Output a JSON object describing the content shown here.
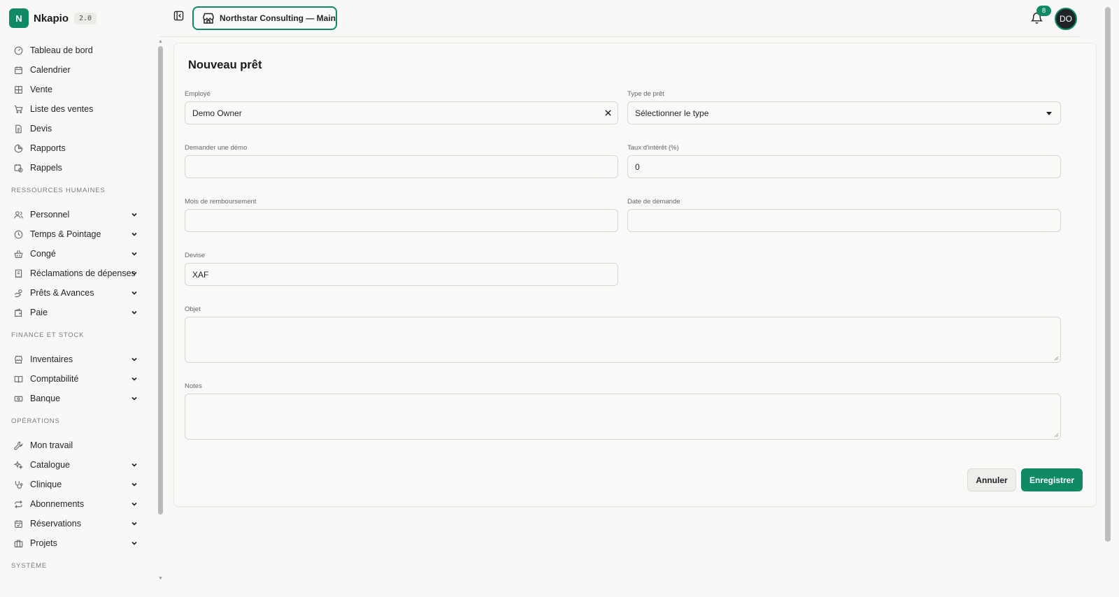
{
  "brand": {
    "logo_letter": "N",
    "name": "Nkapio",
    "version": "2.0"
  },
  "sidebar": {
    "main_items": [
      {
        "label": "Tableau de bord",
        "icon": "dashboard-gauge-icon"
      },
      {
        "label": "Calendrier",
        "icon": "calendar-icon"
      },
      {
        "label": "Vente",
        "icon": "grid-icon"
      },
      {
        "label": "Liste des ventes",
        "icon": "cart-icon"
      },
      {
        "label": "Devis",
        "icon": "document-icon"
      },
      {
        "label": "Rapports",
        "icon": "pie-chart-icon"
      },
      {
        "label": "Rappels",
        "icon": "calendar-clock-icon"
      }
    ],
    "sections": [
      {
        "title": "RESSOURCES HUMAINES",
        "items": [
          {
            "label": "Personnel",
            "icon": "users-icon"
          },
          {
            "label": "Temps & Pointage",
            "icon": "clock-icon"
          },
          {
            "label": "Congé",
            "icon": "basket-icon"
          },
          {
            "label": "Réclamations de dépenses",
            "icon": "receipt-icon"
          },
          {
            "label": "Prêts & Avances",
            "icon": "hand-coins-icon"
          },
          {
            "label": "Paie",
            "icon": "wallet-icon"
          }
        ]
      },
      {
        "title": "FINANCE ET STOCK",
        "items": [
          {
            "label": "Inventaires",
            "icon": "store-icon"
          },
          {
            "label": "Comptabilité",
            "icon": "book-icon"
          },
          {
            "label": "Banque",
            "icon": "banknote-icon"
          }
        ]
      },
      {
        "title": "OPÉRATIONS",
        "items": [
          {
            "label": "Mon travail",
            "icon": "wrench-icon"
          },
          {
            "label": "Catalogue",
            "icon": "sparkles-icon"
          },
          {
            "label": "Clinique",
            "icon": "stethoscope-icon"
          },
          {
            "label": "Abonnements",
            "icon": "repeat-icon"
          },
          {
            "label": "Réservations",
            "icon": "calendar-check-icon"
          },
          {
            "label": "Projets",
            "icon": "briefcase-icon"
          }
        ]
      }
    ],
    "system_section_title": "SYSTÈME"
  },
  "header": {
    "store_label": "Northstar Consulting — Main",
    "notification_count": "8",
    "avatar_initials": "DO"
  },
  "form": {
    "title": "Nouveau prêt",
    "employee": {
      "label": "Employé",
      "value": "Demo Owner"
    },
    "loan_type": {
      "label": "Type de prêt",
      "value": "Sélectionner le type"
    },
    "request_demo": {
      "label": "Demander une démo",
      "value": ""
    },
    "interest_rate": {
      "label": "Taux d'intérêt (%)",
      "value": "0"
    },
    "repayment_months": {
      "label": "Mois de remboursement",
      "value": ""
    },
    "request_date": {
      "label": "Date de demande",
      "value": ""
    },
    "currency": {
      "label": "Devise",
      "value": "XAF"
    },
    "purpose": {
      "label": "Objet",
      "value": ""
    },
    "notes": {
      "label": "Notes",
      "value": ""
    },
    "cancel_label": "Annuler",
    "save_label": "Enregistrer"
  },
  "colors": {
    "accent": "#0f8a65",
    "background": "#f9f8f6",
    "text": "#1f2328"
  }
}
